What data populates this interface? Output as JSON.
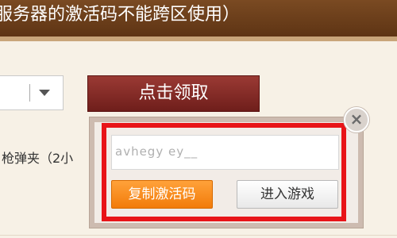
{
  "banner": {
    "text": "服务器的激活码不能跨区使用）"
  },
  "claim": {
    "label": "点击领取"
  },
  "item": {
    "text": "枪弹夹（2小"
  },
  "popup": {
    "code_value": "avhegy ey__",
    "copy_label": "复制激活码",
    "enter_label": "进入游戏",
    "close_symbol": "×"
  }
}
